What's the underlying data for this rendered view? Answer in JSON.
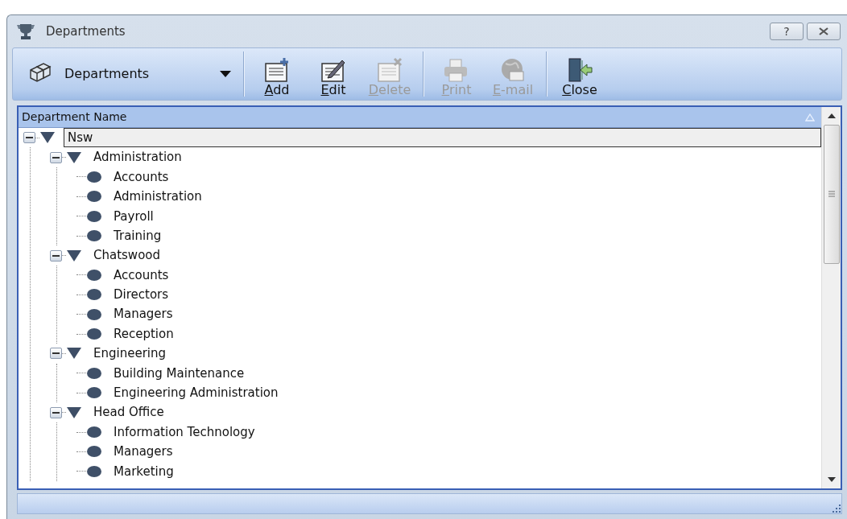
{
  "window": {
    "title": "Departments",
    "buttons": [
      {
        "kind": "help",
        "label": "?"
      },
      {
        "kind": "close"
      }
    ]
  },
  "toolbar": {
    "selector": {
      "label": "Departments"
    },
    "groups": [
      [
        {
          "kind": "add",
          "label": "Add",
          "disabled": false
        },
        {
          "kind": "edit",
          "label": "Edit",
          "disabled": false
        },
        {
          "kind": "delete",
          "label": "Delete",
          "disabled": true
        }
      ],
      [
        {
          "kind": "print",
          "label": "Print",
          "disabled": true
        },
        {
          "kind": "email",
          "label": "E-mail",
          "disabled": true
        }
      ],
      [
        {
          "kind": "close",
          "label": "Close",
          "disabled": false
        }
      ]
    ]
  },
  "grid": {
    "columns": [
      {
        "label": "Department Name",
        "sorted_ascending": true
      }
    ],
    "tree": [
      {
        "label": "Nsw",
        "expanded": true,
        "selected": true,
        "children": [
          {
            "label": "Administration",
            "expanded": true,
            "selected": false,
            "children": [
              {
                "label": "Accounts",
                "selected": false
              },
              {
                "label": "Administration",
                "selected": false
              },
              {
                "label": "Payroll",
                "selected": false
              },
              {
                "label": "Training",
                "selected": false
              }
            ]
          },
          {
            "label": "Chatswood",
            "expanded": true,
            "selected": false,
            "children": [
              {
                "label": "Accounts",
                "selected": false
              },
              {
                "label": "Directors",
                "selected": false
              },
              {
                "label": "Managers",
                "selected": false
              },
              {
                "label": "Reception",
                "selected": false
              }
            ]
          },
          {
            "label": "Engineering",
            "expanded": true,
            "selected": false,
            "children": [
              {
                "label": "Building Maintenance",
                "selected": false
              },
              {
                "label": "Engineering Administration",
                "selected": false
              }
            ]
          },
          {
            "label": "Head Office",
            "expanded": true,
            "selected": false,
            "children": [
              {
                "label": "Information Technology",
                "selected": false
              },
              {
                "label": "Managers",
                "selected": false
              },
              {
                "label": "Marketing",
                "selected": false
              }
            ]
          }
        ]
      }
    ]
  }
}
